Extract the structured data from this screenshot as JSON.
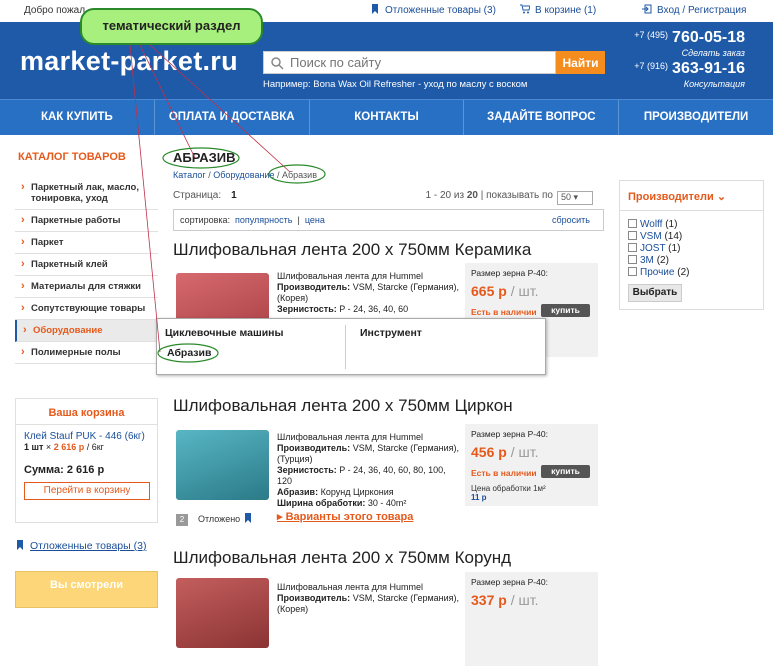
{
  "topbar": {
    "greeting": "Добро пожал",
    "favorites": "Отложенные товары (3)",
    "cart": "В корзине (1)",
    "login": "Вход / Регистрация"
  },
  "header": {
    "logo": "market-parket.ru",
    "search_placeholder": "Поиск по сайту",
    "search_button": "Найти",
    "example_prefix": "Например:",
    "example_link": "Bona Wax Oil Refresher - уход по маслу с воском",
    "phone1_code": "+7 (495)",
    "phone1": "760-05-18",
    "phone1_sub": "Сделать заказ",
    "phone2_code": "+7 (916)",
    "phone2": "363-91-16",
    "phone2_sub": "Консультация"
  },
  "nav": [
    "КАК КУПИТЬ",
    "ОПЛАТА И ДОСТАВКА",
    "КОНТАКТЫ",
    "ЗАДАЙТЕ ВОПРОС",
    "ПРОИЗВОДИТЕЛИ"
  ],
  "sidebar": {
    "title": "КАТАЛОГ ТОВАРОВ",
    "items": [
      {
        "label": "Паркетный лак, масло, тонировка, уход"
      },
      {
        "label": "Паркетные работы"
      },
      {
        "label": "Паркет"
      },
      {
        "label": "Паркетный клей"
      },
      {
        "label": "Материалы для стяжки"
      },
      {
        "label": "Сопутствующие товары"
      },
      {
        "label": "Оборудование"
      },
      {
        "label": "Полимерные полы"
      }
    ],
    "cart": {
      "title": "Ваша корзина",
      "item": "Клей Stauf PUK - 446 (6кг)",
      "qty": "1 шт",
      "price": "2 616 р",
      "unit": "/ 6кг",
      "sum": "Сумма: 2 616 р",
      "button": "Перейти в корзину"
    },
    "favorites": "Отложенные товары (3)",
    "viewed": "Вы смотрели"
  },
  "main": {
    "title": "АБРАЗИВ",
    "breadcrumb": [
      "Каталог",
      "Оборудование",
      "Абразив"
    ],
    "page_label": "Страница:",
    "page": "1",
    "range": "1 - 20 из",
    "total": "20",
    "per_page_label": "показывать по",
    "per_page": "50",
    "sort_label": "сортировка:",
    "sort_popular": "популярность",
    "sort_price": "цена",
    "reset": "сбросить"
  },
  "products": [
    {
      "title": "Шлифовальная лента 200 х 750мм Керамика",
      "line1": "Шлифовальная лента для Hummel",
      "maker_label": "Производитель:",
      "maker": "VSM, Starcke (Германия), (Корея)",
      "grit_label": "Зернистость:",
      "grit": "P - 24, 36, 40, 60",
      "size": "Размер зерна P-40:",
      "price": "665 р",
      "unit": "/ шт.",
      "avail": "Есть в наличии",
      "buy": "купить",
      "color": "#c9575c"
    },
    {
      "title": "Шлифовальная лента 200 х 750мм Циркон",
      "line1": "Шлифовальная лента для Hummel",
      "maker_label": "Производитель:",
      "maker": "VSM, Starcke (Германия), (Турция)",
      "grit_label": "Зернистость:",
      "grit": "P - 24, 36, 40, 60, 80, 100, 120",
      "abr_label": "Абразив:",
      "abr": "Корунд Циркония",
      "width_label": "Ширина обработки:",
      "width": "30 - 40m²",
      "variants": "Варианты этого товара",
      "size": "Размер зерна P-40:",
      "price": "456 р",
      "unit": "/ шт.",
      "avail": "Есть в наличии",
      "buy": "купить",
      "time": "Цена обработки 1м²",
      "time_val": "11 р",
      "num": "2",
      "deferred": "Отложено",
      "color": "#3e9bab"
    },
    {
      "title": "Шлифовальная лента 200 х 750мм Корунд",
      "line1": "Шлифовальная лента для Hummel",
      "maker_label": "Производитель:",
      "maker": "VSM, Starcke (Германия), (Корея)",
      "size": "Размер зерна P-40:",
      "price": "337 р",
      "unit": "/ шт.",
      "color": "#b34b4b"
    }
  ],
  "manufacturers": {
    "title": "Производители",
    "items": [
      {
        "name": "Wolff",
        "count": "(1)"
      },
      {
        "name": "VSM",
        "count": "(14)"
      },
      {
        "name": "JOST",
        "count": "(1)"
      },
      {
        "name": "3M",
        "count": "(2)"
      },
      {
        "name": "Прочие",
        "count": "(2)"
      }
    ],
    "button": "Выбрать"
  },
  "dropdown": {
    "col1": "Циклевочные машины",
    "col2": "Инструмент",
    "sub": "Абразив"
  },
  "annotation": "тематический раздел"
}
